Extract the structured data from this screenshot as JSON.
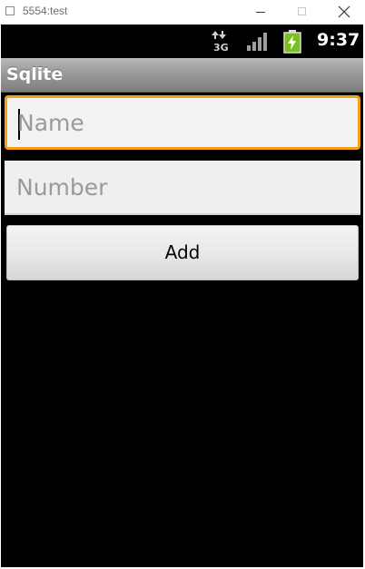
{
  "window": {
    "title": "5554:test"
  },
  "statusbar": {
    "network_icon": "3g-data-icon",
    "signal_icon": "signal-strength-icon",
    "battery_icon": "battery-charging-icon",
    "time": "9:37",
    "colors": {
      "battery": "#7ac01f",
      "icons": "#9e9e9e"
    }
  },
  "app": {
    "title": "Sqlite"
  },
  "form": {
    "name_placeholder": "Name",
    "name_value": "",
    "number_placeholder": "Number",
    "number_value": "",
    "add_label": "Add"
  },
  "colors": {
    "focus_border": "#f7a11a",
    "screen_background": "#000000"
  }
}
